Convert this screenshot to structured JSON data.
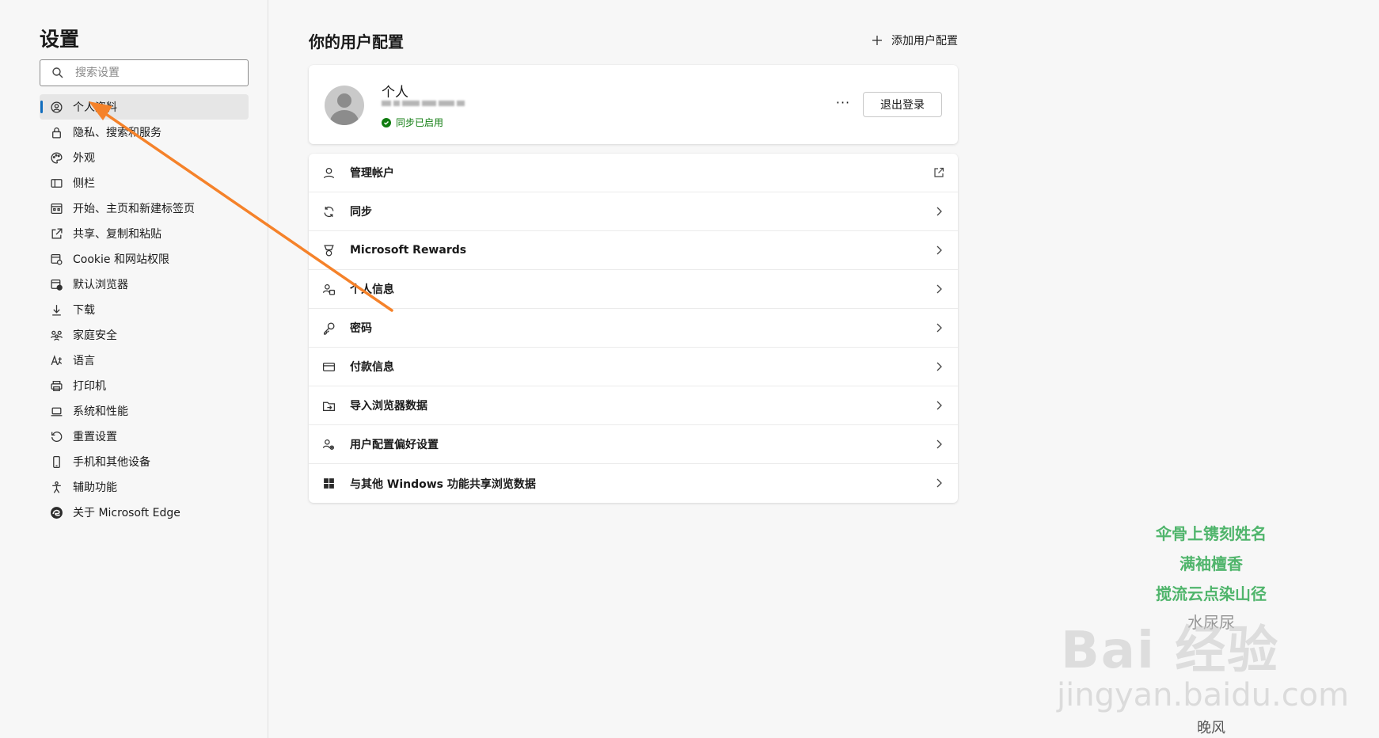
{
  "sidebar": {
    "title": "设置",
    "search_placeholder": "搜索设置",
    "items": [
      {
        "label": "个人资料",
        "icon": "profile-icon",
        "active": true
      },
      {
        "label": "隐私、搜索和服务",
        "icon": "lock-icon"
      },
      {
        "label": "外观",
        "icon": "palette-icon"
      },
      {
        "label": "侧栏",
        "icon": "sidebar-icon"
      },
      {
        "label": "开始、主页和新建标签页",
        "icon": "home-tab-icon"
      },
      {
        "label": "共享、复制和粘贴",
        "icon": "share-icon"
      },
      {
        "label": "Cookie 和网站权限",
        "icon": "cookie-permissions-icon"
      },
      {
        "label": "默认浏览器",
        "icon": "default-browser-icon"
      },
      {
        "label": "下载",
        "icon": "download-icon"
      },
      {
        "label": "家庭安全",
        "icon": "family-icon"
      },
      {
        "label": "语言",
        "icon": "language-icon"
      },
      {
        "label": "打印机",
        "icon": "printer-icon"
      },
      {
        "label": "系统和性能",
        "icon": "laptop-icon"
      },
      {
        "label": "重置设置",
        "icon": "reset-icon"
      },
      {
        "label": "手机和其他设备",
        "icon": "phone-icon"
      },
      {
        "label": "辅助功能",
        "icon": "accessibility-icon"
      },
      {
        "label": "关于 Microsoft Edge",
        "icon": "edge-logo-icon"
      }
    ]
  },
  "main": {
    "title": "你的用户配置",
    "add_profile_label": "添加用户配置",
    "profile": {
      "name": "个人",
      "sync_status": "同步已启用",
      "more_label": "···",
      "signout_label": "退出登录"
    },
    "rows": [
      {
        "label": "管理帐户",
        "icon": "person-icon",
        "trail": "external-link-icon"
      },
      {
        "label": "同步",
        "icon": "sync-icon",
        "trail": "chevron-right-icon"
      },
      {
        "label": "Microsoft Rewards",
        "icon": "rewards-icon",
        "trail": "chevron-right-icon"
      },
      {
        "label": "个人信息",
        "icon": "personal-info-icon",
        "trail": "chevron-right-icon"
      },
      {
        "label": "密码",
        "icon": "key-icon",
        "trail": "chevron-right-icon"
      },
      {
        "label": "付款信息",
        "icon": "card-icon",
        "trail": "chevron-right-icon"
      },
      {
        "label": "导入浏览器数据",
        "icon": "import-icon",
        "trail": "chevron-right-icon"
      },
      {
        "label": "用户配置偏好设置",
        "icon": "profile-prefs-icon",
        "trail": "chevron-right-icon"
      },
      {
        "label": "与其他 Windows 功能共享浏览数据",
        "icon": "windows-icon",
        "trail": "chevron-right-icon"
      }
    ]
  },
  "watermark": {
    "poem_lines": [
      "伞骨上镌刻姓名",
      "满袖檀香",
      "搅流云点染山径",
      "水尿尿"
    ],
    "brand": "Bai 经验",
    "domain": "jingyan.baidu.com",
    "author": "晚风"
  },
  "colors": {
    "accent": "#0f6cbd",
    "sync_green": "#107c10",
    "annotation_arrow": "#f5822a"
  }
}
